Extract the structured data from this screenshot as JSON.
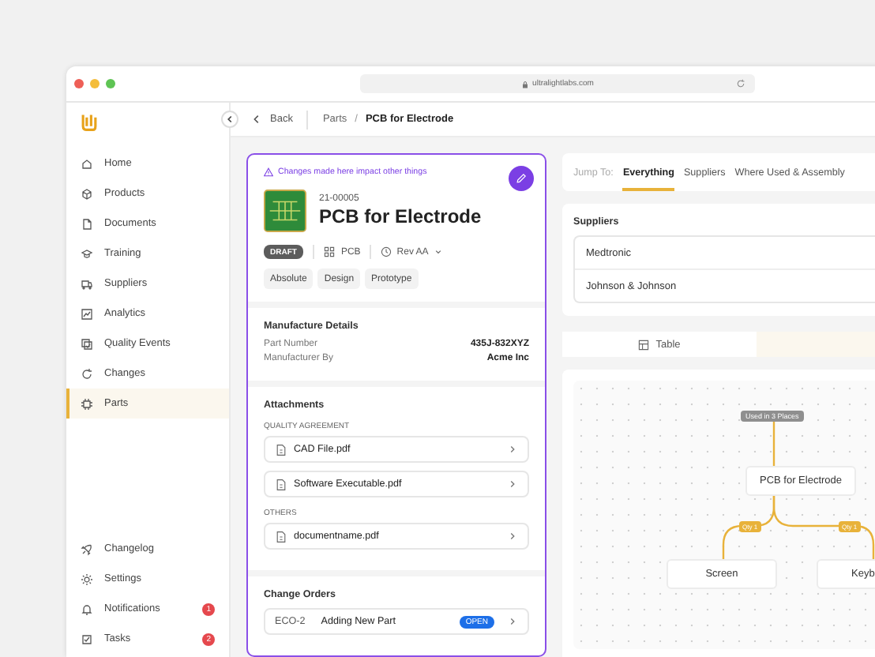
{
  "browser": {
    "url": "ultralightlabs.com"
  },
  "sidebar": {
    "items": [
      {
        "label": "Home",
        "selected": false
      },
      {
        "label": "Products",
        "selected": false
      },
      {
        "label": "Documents",
        "selected": false
      },
      {
        "label": "Training",
        "selected": false
      },
      {
        "label": "Suppliers",
        "selected": false
      },
      {
        "label": "Analytics",
        "selected": false
      },
      {
        "label": "Quality Events",
        "selected": false
      },
      {
        "label": "Changes",
        "selected": false
      },
      {
        "label": "Parts",
        "selected": true
      }
    ],
    "bottom_items": [
      {
        "label": "Changelog"
      },
      {
        "label": "Settings"
      },
      {
        "label": "Notifications",
        "badge": "1"
      },
      {
        "label": "Tasks",
        "badge": "2"
      }
    ]
  },
  "header": {
    "back": "Back",
    "breadcrumb": [
      "Parts",
      "PCB for Electrode"
    ],
    "separator": "/"
  },
  "part": {
    "warning": "Changes made here impact other things",
    "number": "21-00005",
    "name": "PCB for Electrode",
    "status": "DRAFT",
    "type": "PCB",
    "revision": "Rev AA",
    "tags": [
      "Absolute",
      "Design",
      "Prototype"
    ]
  },
  "manufacture": {
    "title": "Manufacture Details",
    "fields": [
      {
        "label": "Part Number",
        "value": "435J-832XYZ"
      },
      {
        "label": "Manufacturer By",
        "value": "Acme Inc"
      }
    ]
  },
  "attachments": {
    "title": "Attachments",
    "groups": [
      {
        "heading": "QUALITY AGREEMENT",
        "files": [
          "CAD File.pdf",
          "Software Executable.pdf"
        ]
      },
      {
        "heading": "OTHERS",
        "files": [
          "documentname.pdf"
        ]
      }
    ]
  },
  "change_orders": {
    "title": "Change Orders",
    "rows": [
      {
        "id": "ECO-2",
        "name": "Adding New Part",
        "status": "OPEN"
      }
    ]
  },
  "jump_to": {
    "label": "Jump To:",
    "tabs": [
      {
        "label": "Everything",
        "selected": true
      },
      {
        "label": "Suppliers",
        "selected": false
      },
      {
        "label": "Where Used & Assembly",
        "selected": false
      }
    ]
  },
  "suppliers": {
    "title": "Suppliers",
    "items": [
      "Medtronic",
      "Johnson & Johnson"
    ]
  },
  "view_toggle": [
    {
      "label": "Table",
      "selected": false
    },
    {
      "selected": true
    }
  ],
  "diagram": {
    "used_in": "Used in 3 Places",
    "root": "PCB for Electrode",
    "children": [
      {
        "name": "Screen",
        "qty": "Qty 1"
      },
      {
        "name": "Keyb",
        "qty": "Qty 1"
      }
    ]
  }
}
